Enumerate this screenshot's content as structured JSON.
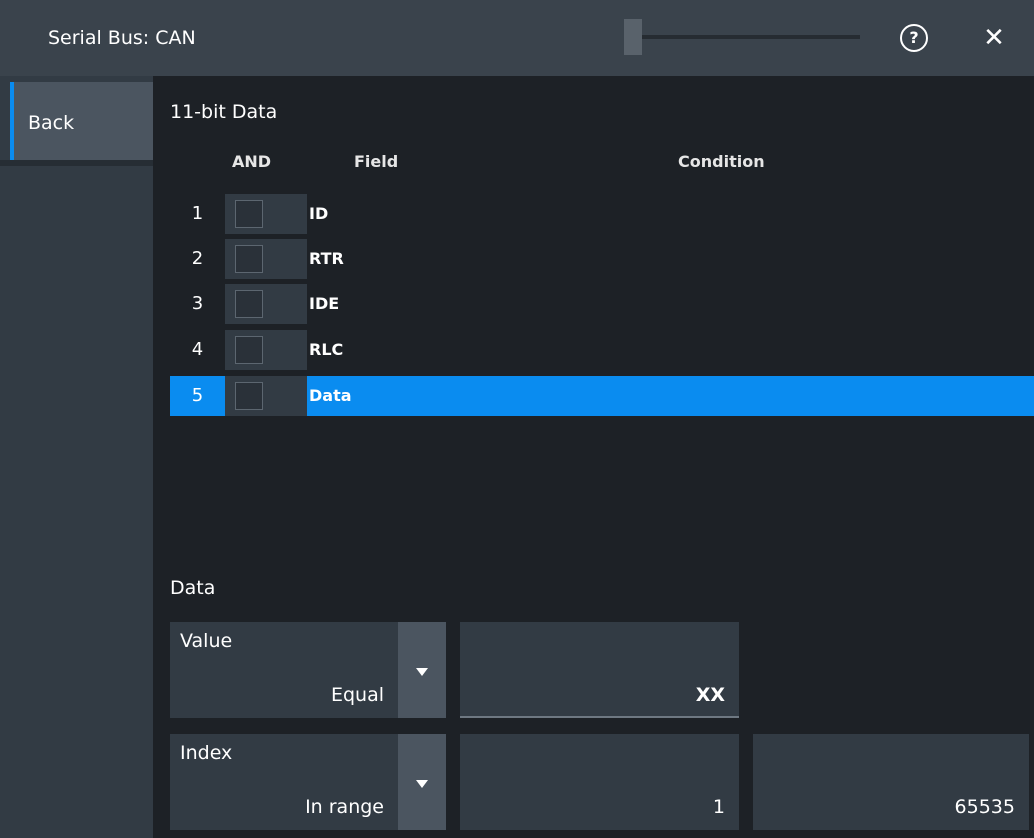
{
  "window": {
    "title": "Serial Bus: CAN"
  },
  "sidebar": {
    "back_label": "Back"
  },
  "frame": {
    "title": "11-bit Data",
    "headers": {
      "and": "AND",
      "field": "Field",
      "condition": "Condition"
    },
    "rows": [
      {
        "num": "1",
        "field": "ID",
        "checked": false,
        "selected": false
      },
      {
        "num": "2",
        "field": "RTR",
        "checked": false,
        "selected": false
      },
      {
        "num": "3",
        "field": "IDE",
        "checked": false,
        "selected": false
      },
      {
        "num": "4",
        "field": "RLC",
        "checked": false,
        "selected": false
      },
      {
        "num": "5",
        "field": "Data",
        "checked": false,
        "selected": true
      }
    ]
  },
  "data_section": {
    "title": "Data",
    "value": {
      "label": "Value",
      "selected": "Equal",
      "field": "XX"
    },
    "index": {
      "label": "Index",
      "selected": "In range",
      "min": "1",
      "max": "65535"
    }
  },
  "colors": {
    "accent": "#0a8cf0",
    "panel": "#323b44",
    "background": "#1d2126"
  },
  "icons": {
    "help": "help-circle-icon",
    "close": "close-icon",
    "dropdown": "triangle-down-icon"
  }
}
